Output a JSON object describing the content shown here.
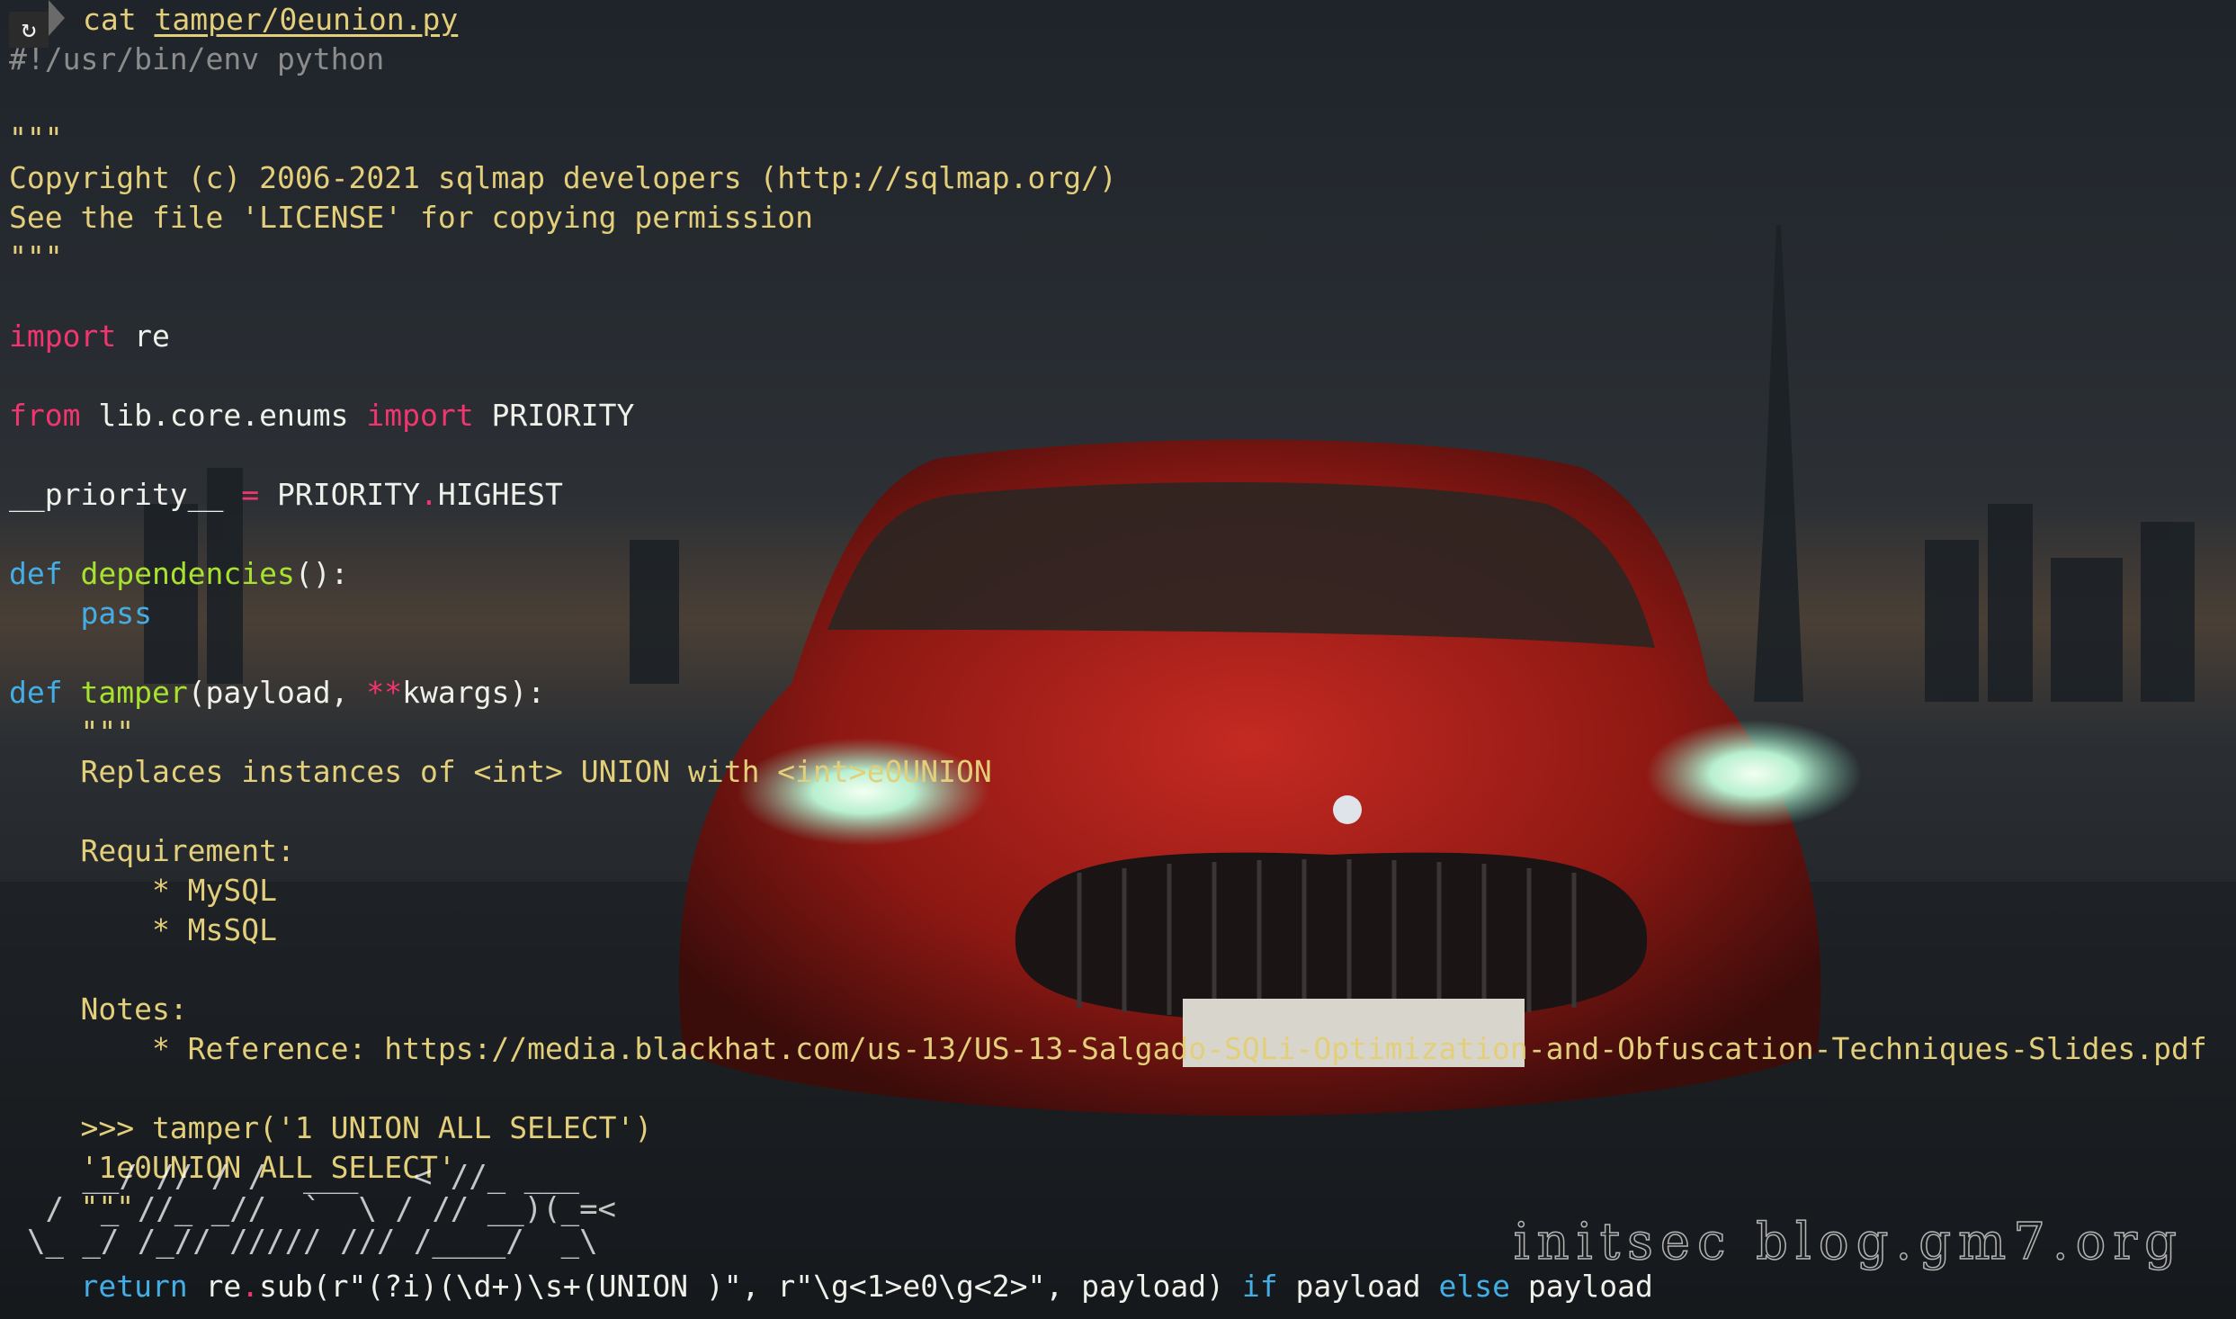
{
  "prompt": {
    "icon": "refresh-icon",
    "command": "cat",
    "argument": "tamper/0eunion.py"
  },
  "watermark": "initsec blog.gm7.org",
  "ascii_logo": [
    "   __/ // / /  ___   < //_ ___",
    " /  _ //_ _//  `  \\ / // __)(_=<",
    "\\_ _/ /_// ///// /// /____/  _\\",
    ""
  ],
  "code": {
    "shebang": "#!/usr/bin/env python",
    "docq1": "\"\"\"",
    "copyright": "Copyright (c) 2006-2021 sqlmap developers (http://sqlmap.org/)",
    "license": "See the file 'LICENSE' for copying permission",
    "docq2": "\"\"\"",
    "import_kw": "import",
    "import_mod": " re",
    "from_kw": "from",
    "from_mod": " lib.core.enums ",
    "from_import_kw": "import",
    "from_name": " PRIORITY",
    "prio_lhs": "__priority__ ",
    "prio_eq": "=",
    "prio_obj": " PRIORITY",
    "prio_dot": ".",
    "prio_attr": "HIGHEST",
    "def1_kw": "def",
    "def1_name": " dependencies",
    "def1_rest": "():",
    "pass_kw": "    pass",
    "def2_kw": "def",
    "def2_name": " tamper",
    "def2_args1": "(payload, ",
    "def2_star": "**",
    "def2_args2": "kwargs):",
    "doc3": "    \"\"\"",
    "doc_replaces": "    Replaces instances of <int> UNION with <int>e0UNION",
    "doc_req": "    Requirement:",
    "doc_mysql": "        * MySQL",
    "doc_mssql": "        * MsSQL",
    "doc_notes": "    Notes:",
    "doc_ref": "        * Reference: https://media.blackhat.com/us-13/US-13-Salgado-SQLi-Optimization-and-Obfuscation-Techniques-Slides.pdf",
    "doc_ex1": "    >>> tamper('1 UNION ALL SELECT')",
    "doc_ex2": "    '1e0UNION ALL SELECT'",
    "doc4": "    \"\"\"",
    "ret_kw": "    return",
    "ret_re": " re",
    "ret_dot": ".",
    "ret_call": "sub(r\"(?i)(\\d+)\\s+(UNION )\", r\"\\g<1>e0\\g<2>\", payload) ",
    "ret_if": "if",
    "ret_payload1": " payload ",
    "ret_else": "else",
    "ret_payload2": " payload"
  },
  "colors": {
    "keyword": "#f3356f",
    "def": "#43aee6",
    "function": "#a6e22e",
    "string": "#e3cf7a",
    "comment": "#8c8c8c",
    "car": "#b51e1a"
  }
}
